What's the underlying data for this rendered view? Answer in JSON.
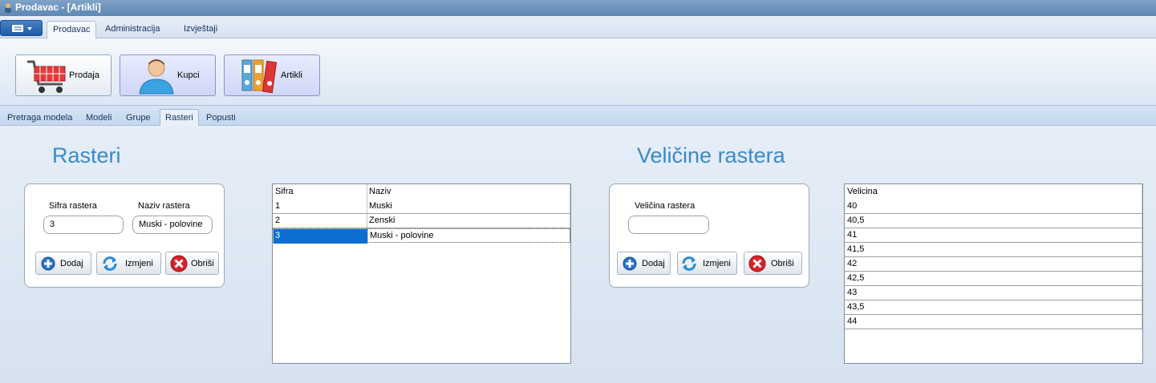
{
  "window": {
    "title": "Prodavac - [Artikli]"
  },
  "ribbon": {
    "tabs": [
      "Prodavac",
      "Administracija",
      "Izvještaji"
    ],
    "buttons": {
      "prodaja": "Prodaja",
      "kupci": "Kupci",
      "artikli": "Artikli"
    }
  },
  "subtabs": [
    "Pretraga modela",
    "Modeli",
    "Grupe",
    "Rasteri",
    "Popusti"
  ],
  "rasteri": {
    "heading": "Rasteri",
    "sifra_label": "Sifra rastera",
    "naziv_label": "Naziv rastera",
    "sifra_value": "3",
    "naziv_value": "Muski - polovine",
    "buttons": {
      "add": "Dodaj",
      "edit": "Izmjeni",
      "delete": "Obriši"
    },
    "grid": {
      "columns": [
        "Sifra",
        "Naziv"
      ],
      "rows": [
        {
          "sifra": "1",
          "naziv": "Muski"
        },
        {
          "sifra": "2",
          "naziv": "Zenski"
        },
        {
          "sifra": "3",
          "naziv": "Muski - polovine"
        }
      ]
    }
  },
  "velicine": {
    "heading": "Veličine rastera",
    "label": "Veličina rastera",
    "value": "",
    "buttons": {
      "add": "Dodaj",
      "edit": "Izmjeni",
      "delete": "Obriši"
    },
    "grid": {
      "columns": [
        "Velicina"
      ],
      "rows": [
        "40",
        "40,5",
        "41",
        "41,5",
        "42",
        "42,5",
        "43",
        "43,5",
        "44"
      ]
    }
  }
}
